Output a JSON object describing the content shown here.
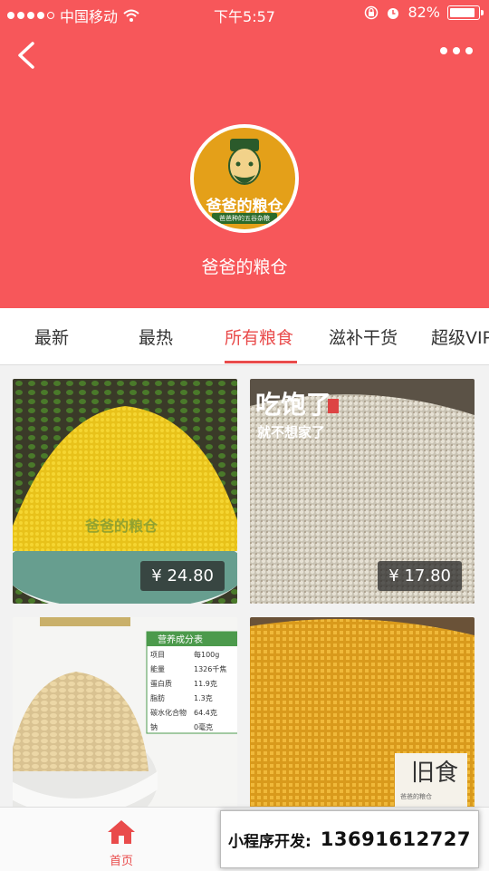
{
  "status_bar": {
    "carrier": "中国移动",
    "time": "下午5:57",
    "battery": "82%",
    "battery_level": 0.82,
    "signal_bars": 4
  },
  "header": {
    "store_name": "爸爸的粮仓",
    "logo_text": "爸爸的粮仓",
    "logo_tagline": "爸爸种的五谷杂粮",
    "background_color": "#f7575a"
  },
  "tabs": [
    {
      "label": "最新",
      "active": false
    },
    {
      "label": "最热",
      "active": false
    },
    {
      "label": "所有粮食",
      "active": true
    },
    {
      "label": "滋补干货",
      "active": false
    },
    {
      "label": "超级VIP",
      "active": false
    }
  ],
  "products": [
    {
      "price": "¥ 24.80",
      "image": "yellow-millet-photo",
      "watermark": "爸爸的粮仓"
    },
    {
      "price": "¥ 17.80",
      "image": "sorghum-rice-photo",
      "overlay_text": "吃饱了",
      "overlay_text2": "就不想家了"
    },
    {
      "price": "",
      "image": "barley-bowl-photo",
      "table_title": "营养成分表",
      "table_rows": [
        [
          "项目",
          "每100g"
        ],
        [
          "能量",
          "1326千焦"
        ],
        [
          "蛋白质",
          "11.9克"
        ],
        [
          "脂肪",
          "1.3克"
        ],
        [
          "碳水化合物",
          "64.4克"
        ],
        [
          "钠",
          "0毫克"
        ]
      ]
    },
    {
      "price": "",
      "image": "corn-grits-photo",
      "overlay_text": "旧食",
      "overlay_small": "爸爸的粮仓"
    }
  ],
  "tabbar": {
    "home_label": "首页"
  },
  "contact": {
    "label": "小程序开发:",
    "phone": "13691612727"
  },
  "colors": {
    "accent": "#e94b4b",
    "header": "#f7575a"
  }
}
